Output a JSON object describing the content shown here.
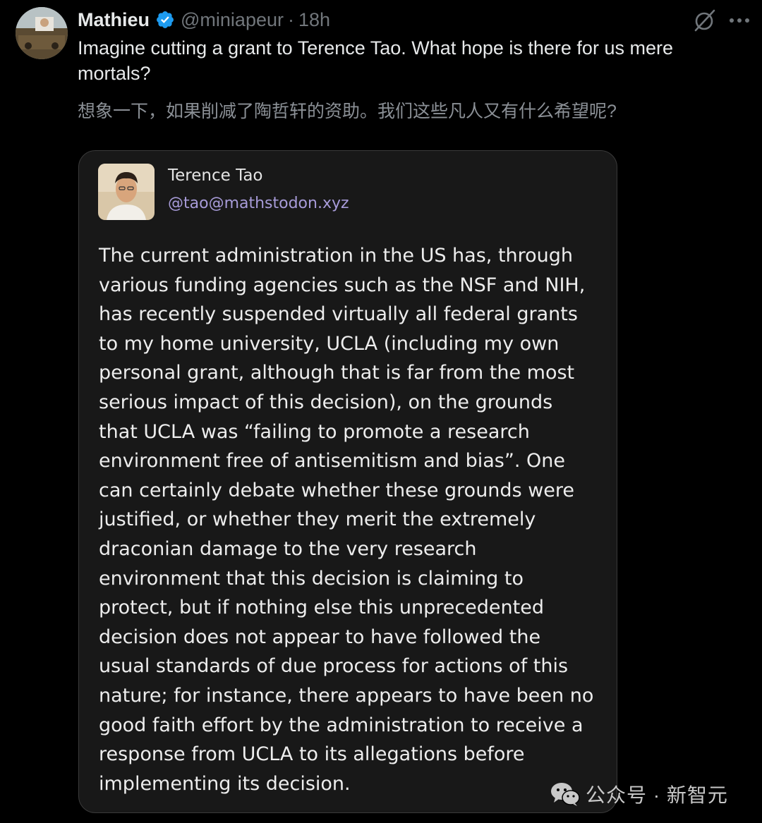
{
  "tweet": {
    "author": {
      "display_name": "Mathieu",
      "handle": "@miniapeur",
      "verified": true
    },
    "separator": "·",
    "time": "18h",
    "text": "Imagine cutting a grant to Terence Tao. What hope is there for us mere mortals?",
    "translation": "想象一下，如果削减了陶哲轩的资助。我们这些凡人又有什么希望呢?",
    "icons": [
      "grok-icon",
      "more-icon",
      "verified-badge-icon"
    ]
  },
  "quote": {
    "author_name": "Terence Tao",
    "author_handle": "@tao@mathstodon.xyz",
    "body_lines": [
      "The current administration in the US has, through",
      "various funding agencies such as the NSF and NIH,",
      "has recently suspended virtually all federal grants",
      "to my home  university, UCLA (including my own",
      "personal grant, although that is far from the most",
      "serious impact of this decision), on the grounds",
      "that UCLA was “failing to promote a research",
      "environment free of antisemitism and bias”.  One",
      "can certainly debate whether these grounds were",
      "justified, or whether they merit the extremely",
      "draconian damage to the very research",
      "environment that this decision is claiming to",
      "protect, but if nothing else this unprecedented",
      "decision does not appear to have followed the",
      "usual standards of due process for actions of this",
      "nature; for instance, there appears to have been no",
      "good faith effort by the administration to receive a",
      "response from UCLA to its allegations before",
      "implementing its decision."
    ]
  },
  "watermark": {
    "text": "公众号 · 新智元",
    "icon": "wechat-icon"
  },
  "colors": {
    "background": "#000000",
    "verified_blue": "#1d9bf0",
    "secondary_text": "#71767b",
    "card_background": "#181818",
    "handle_purple": "#a79bd8"
  }
}
